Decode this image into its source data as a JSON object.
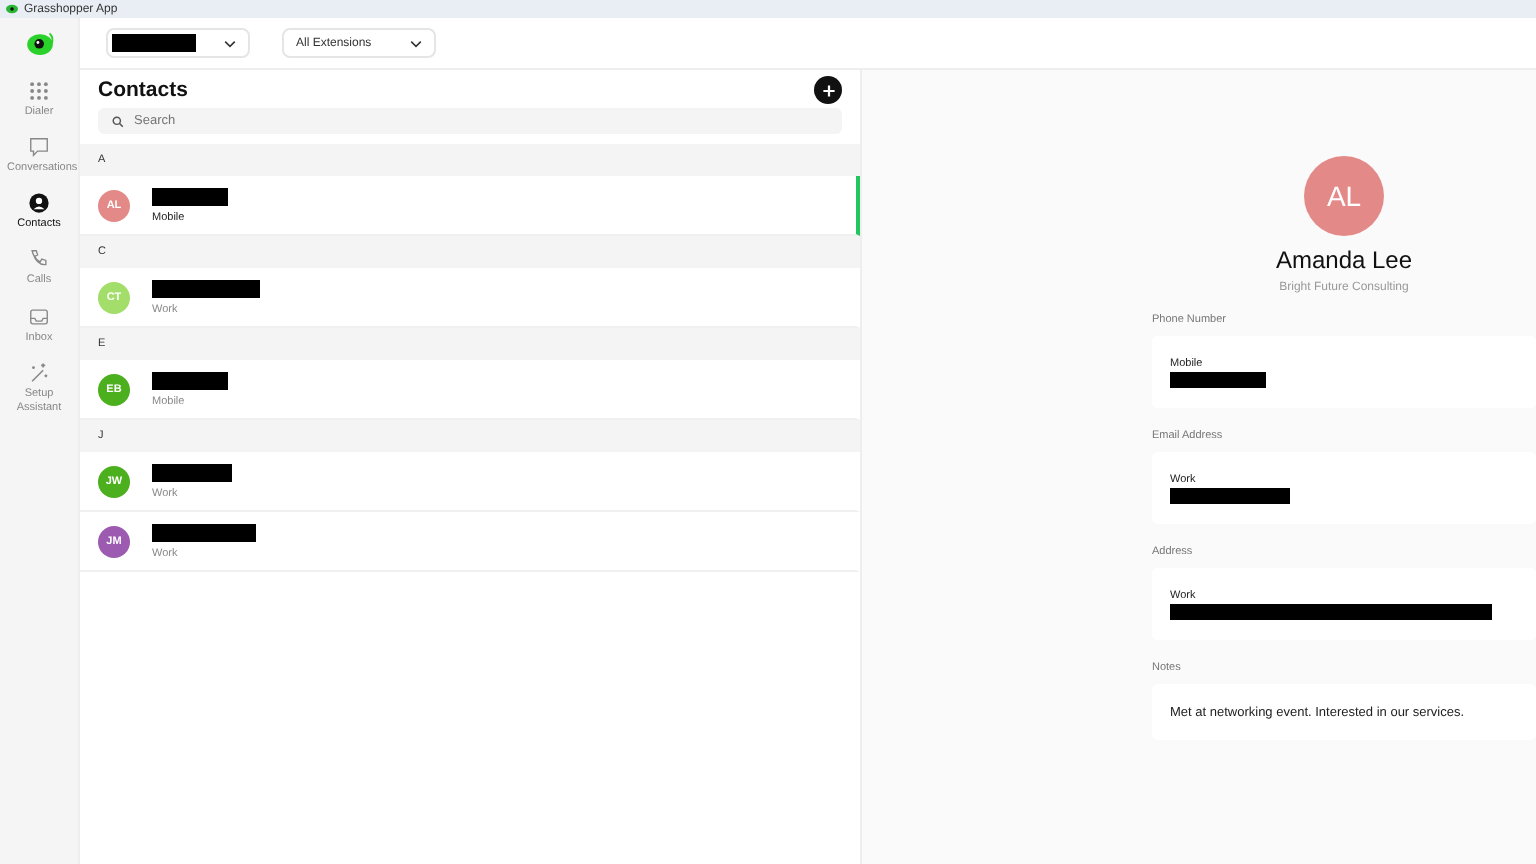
{
  "window": {
    "title": "Grasshopper App"
  },
  "sidebar": {
    "items": [
      {
        "kind": "dialer",
        "label": "Dialer",
        "selected": false
      },
      {
        "kind": "conversations",
        "label": "Conversations",
        "selected": false
      },
      {
        "kind": "contacts",
        "label": "Contacts",
        "selected": true
      },
      {
        "kind": "calls",
        "label": "Calls",
        "selected": false
      },
      {
        "kind": "inbox",
        "label": "Inbox",
        "selected": false
      },
      {
        "kind": "setup",
        "label": "Setup Assistant",
        "selected": false
      }
    ]
  },
  "toolbar": {
    "extension_filter": "All Extensions"
  },
  "contacts": {
    "title": "Contacts",
    "search": {
      "placeholder": "Search"
    },
    "groups": [
      {
        "letter": "A",
        "items": [
          {
            "initials": "AL",
            "color": "#e38a88",
            "type": "Mobile",
            "selected": true
          }
        ]
      },
      {
        "letter": "C",
        "items": [
          {
            "initials": "CT",
            "color": "#a3de6a",
            "type": "Work",
            "selected": false
          }
        ]
      },
      {
        "letter": "E",
        "items": [
          {
            "initials": "EB",
            "color": "#4caf1e",
            "type": "Mobile",
            "selected": false
          }
        ]
      },
      {
        "letter": "J",
        "items": [
          {
            "initials": "JW",
            "color": "#4caf1e",
            "type": "Work",
            "selected": false
          },
          {
            "initials": "JM",
            "color": "#9c5bb0",
            "type": "Work",
            "selected": false
          }
        ]
      }
    ]
  },
  "detail": {
    "initials": "AL",
    "color": "#e38a88",
    "name": "Amanda Lee",
    "company": "Bright Future Consulting",
    "sections": [
      {
        "label": "Phone Number",
        "type": "Mobile",
        "kind": "redacted"
      },
      {
        "label": "Email Address",
        "type": "Work",
        "kind": "redacted"
      },
      {
        "label": "Address",
        "type": "Work",
        "kind": "redacted-long"
      },
      {
        "label": "Notes",
        "kind": "text",
        "text": "Met at networking event. Interested in our services."
      }
    ]
  }
}
